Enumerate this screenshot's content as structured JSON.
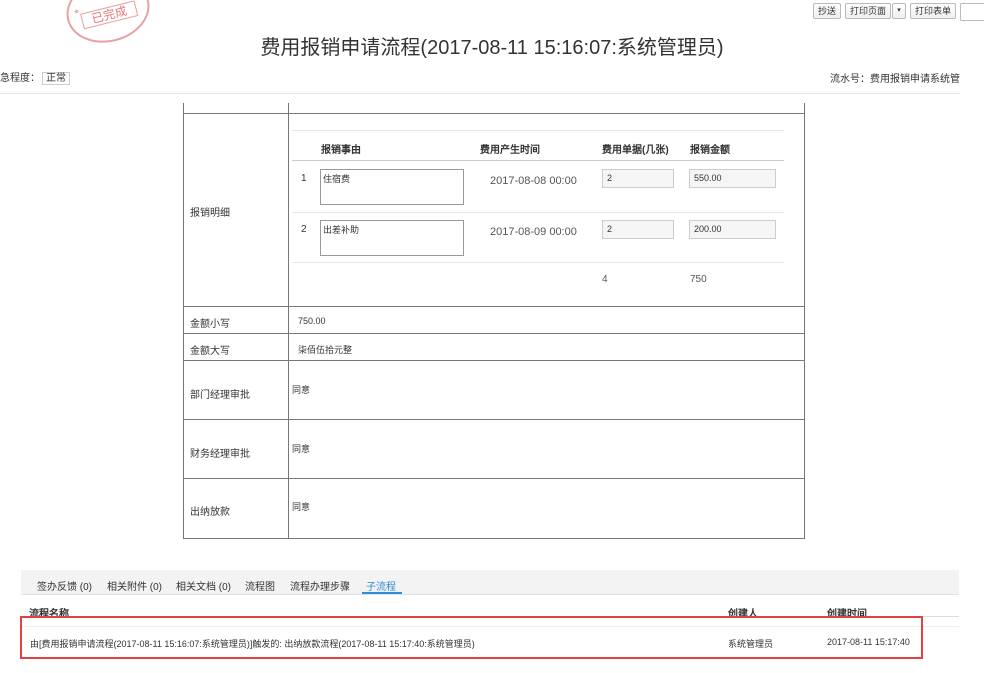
{
  "stamp": {
    "text": "已完成"
  },
  "toolbar": {
    "copy_send": "抄送",
    "print_page": "打印页面",
    "dropdown": "▾",
    "print_form": "打印表单"
  },
  "title": "费用报销申请流程(2017-08-11 15:16:07:系统管理员)",
  "urgency": {
    "label": "急程度：",
    "value": "正常"
  },
  "serial": {
    "label": "流水号：费用报销申请系统管"
  },
  "form": {
    "detail_label": "报销明细",
    "sub_headers": [
      "报销事由",
      "费用产生时间",
      "费用单据(几张)",
      "报销金额"
    ],
    "rows": [
      {
        "num": "1",
        "reason": "住宿费",
        "time": "2017-08-08 00:00",
        "receipts": "2",
        "amount": "550.00"
      },
      {
        "num": "2",
        "reason": "出差补助",
        "time": "2017-08-09 00:00",
        "receipts": "2",
        "amount": "200.00"
      }
    ],
    "totals": {
      "receipts": "4",
      "amount": "750"
    },
    "amount_lower": {
      "label": "金额小写",
      "value": "750.00"
    },
    "amount_upper": {
      "label": "金额大写",
      "value": "柒佰伍拾元整"
    },
    "dept_approval": {
      "label": "部门经理审批",
      "value": "同意"
    },
    "finance_approval": {
      "label": "财务经理审批",
      "value": "同意"
    },
    "cashier": {
      "label": "出纳放款",
      "value": "同意"
    }
  },
  "tabs": [
    "签办反馈 (0)",
    "相关附件 (0)",
    "相关文档 (0)",
    "流程图",
    "流程办理步骤",
    "子流程"
  ],
  "subflow": {
    "headers": [
      "流程名称",
      "创建人",
      "创建时间"
    ],
    "row": {
      "name": "由[费用报销申请流程(2017-08-11 15:16:07:系统管理员)]触发的: 出纳放款流程(2017-08-11 15:17:40:系统管理员)",
      "creator": "系统管理员",
      "time": "2017-08-11 15:17:40"
    }
  },
  "colors": {
    "accent": "#2d8cd7",
    "highlight_border": "#e04343",
    "stamp": "#e07878"
  }
}
